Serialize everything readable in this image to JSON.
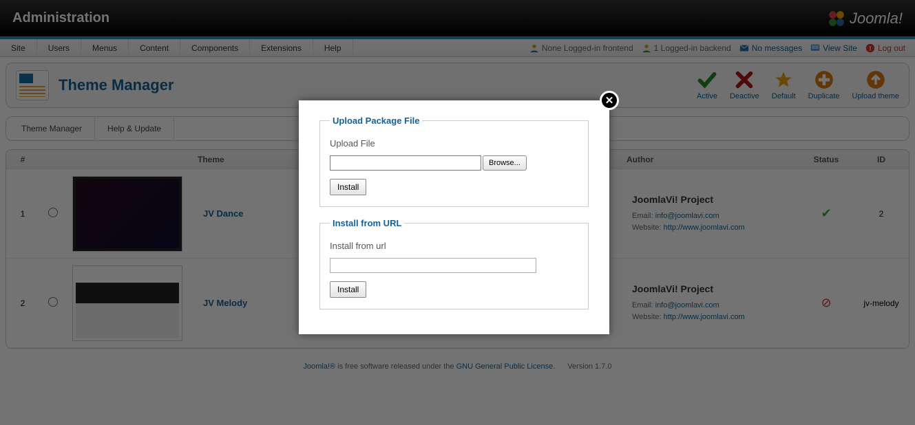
{
  "header": {
    "title": "Administration",
    "brand": "Joomla!"
  },
  "menu": {
    "left": [
      "Site",
      "Users",
      "Menus",
      "Content",
      "Components",
      "Extensions",
      "Help"
    ],
    "right": {
      "frontend": "None Logged-in frontend",
      "backend": "1 Logged-in backend",
      "messages": "No messages",
      "viewSite": "View Site",
      "logout": "Log out"
    }
  },
  "pageTitle": "Theme Manager",
  "toolbar": [
    {
      "key": "active",
      "label": "Active",
      "color": "#2a8a2a",
      "shape": "check"
    },
    {
      "key": "deactive",
      "label": "Deactive",
      "color": "#b01515",
      "shape": "cross"
    },
    {
      "key": "default",
      "label": "Default",
      "color": "#e8a20b",
      "shape": "star"
    },
    {
      "key": "duplicate",
      "label": "Duplicate",
      "color": "#d87a0f",
      "shape": "plus"
    },
    {
      "key": "upload-theme",
      "label": "Upload theme",
      "color": "#d87a0f",
      "shape": "up"
    }
  ],
  "tabs": [
    "Theme Manager",
    "Help & Update"
  ],
  "table": {
    "headers": {
      "num": "#",
      "theme": "Theme",
      "author": "Author",
      "status": "Status",
      "id": "ID"
    },
    "rows": [
      {
        "num": "1",
        "name": "JV Dance",
        "author": {
          "title": "JoomlaVi! Project",
          "emailLabel": "Email:",
          "email": "info@joomlavi.com",
          "websiteLabel": "Website:",
          "website": "http://www.joomlavi.com"
        },
        "status": "ok",
        "id": "2",
        "thumb": "dark"
      },
      {
        "num": "2",
        "name": "JV Melody",
        "author": {
          "title": "JoomlaVi! Project",
          "emailLabel": "Email:",
          "email": "info@joomlavi.com",
          "websiteLabel": "Website:",
          "website": "http://www.joomlavi.com"
        },
        "status": "bad",
        "id": "jv-melody",
        "thumb": "light"
      }
    ]
  },
  "footer": {
    "brand": "Joomla!®",
    "text1": " is free software released under the ",
    "license": "GNU General Public License.",
    "version": "Version 1.7.0"
  },
  "modal": {
    "upload": {
      "legend": "Upload Package File",
      "label": "Upload File",
      "browse": "Browse...",
      "install": "Install"
    },
    "url": {
      "legend": "Install from URL",
      "label": "Install from url",
      "install": "Install"
    }
  }
}
